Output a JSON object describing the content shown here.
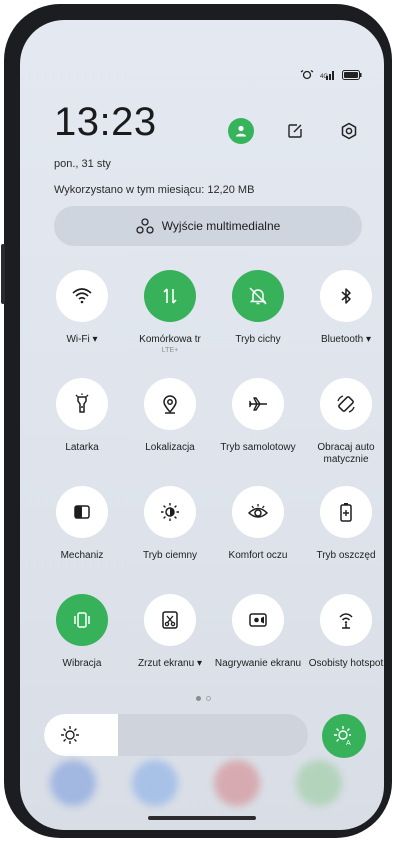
{
  "status": {
    "time": "13:23",
    "date": "pon., 31 sty",
    "usage": "Wykorzystano w tym miesiącu: 12,20 MB"
  },
  "header": {
    "user_icon": "user-icon",
    "edit_icon": "edit-icon",
    "settings_icon": "settings-icon"
  },
  "media": {
    "label": "Wyjście multimedialne"
  },
  "tiles": [
    {
      "label": "Wi-Fi ▾",
      "icon": "wifi-icon",
      "on": false
    },
    {
      "label": "Komórkowa tr",
      "sub": "LTE+",
      "icon": "mobile-data-icon",
      "on": true
    },
    {
      "label": "Tryb cichy",
      "icon": "bell-off-icon",
      "on": true
    },
    {
      "label": "Bluetooth ▾",
      "icon": "bluetooth-icon",
      "on": false
    },
    {
      "label": "Latarka",
      "icon": "flashlight-icon",
      "on": false
    },
    {
      "label": "Lokalizacja",
      "icon": "location-icon",
      "on": false
    },
    {
      "label": "Tryb samolotowy",
      "icon": "airplane-icon",
      "on": false
    },
    {
      "label": "Obracaj auto matycznie",
      "icon": "rotate-icon",
      "on": false
    },
    {
      "label": "Mechaniz",
      "icon": "contrast-icon",
      "on": false
    },
    {
      "label": "Tryb ciemny",
      "icon": "dark-mode-icon",
      "on": false
    },
    {
      "label": "Komfort oczu",
      "icon": "eye-icon",
      "on": false
    },
    {
      "label": "Tryb oszczęd",
      "icon": "battery-saver-icon",
      "on": false
    },
    {
      "label": "Wibracja",
      "icon": "vibrate-icon",
      "on": true
    },
    {
      "label": "Zrzut ekranu ▾",
      "icon": "screenshot-icon",
      "on": false
    },
    {
      "label": "Nagrywanie ekranu",
      "icon": "screen-record-icon",
      "on": false
    },
    {
      "label": "Osobisty hotspot",
      "icon": "hotspot-icon",
      "on": false
    }
  ],
  "page_indicator": {
    "count": 2,
    "active": 1
  },
  "brightness": {
    "level": 0.28
  },
  "colors": {
    "accent": "#37b15a",
    "text": "#1e1e20"
  }
}
